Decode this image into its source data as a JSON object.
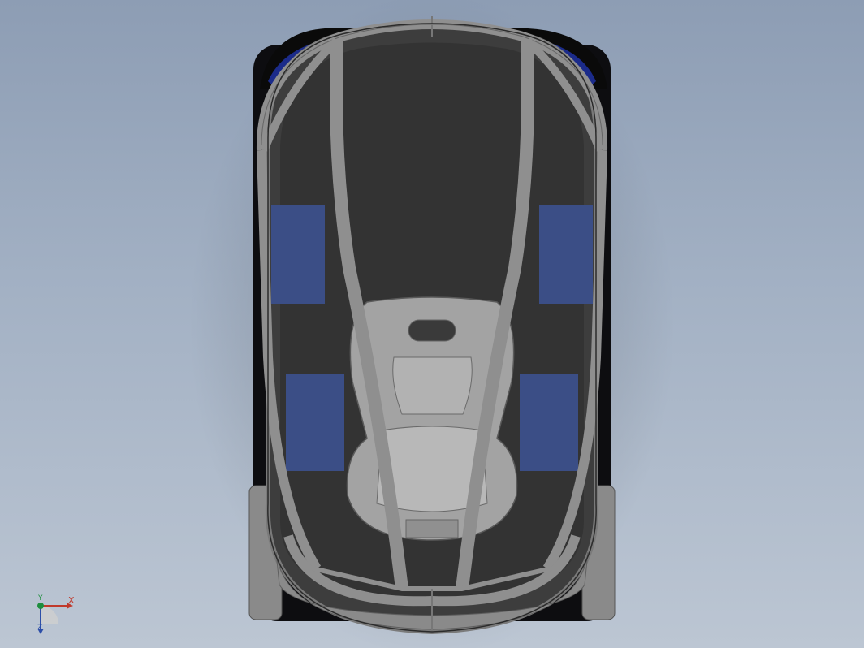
{
  "viewport": {
    "title": "",
    "triad": {
      "x_label": "X",
      "y_label": "Y",
      "z_label": "Z",
      "x_color": "#c0392b",
      "y_color": "#1e8e3e",
      "z_color": "#2c4ea8"
    }
  },
  "model": {
    "body_color": "#3d3d3d",
    "frame_color": "#8f8f8f",
    "panel_color": "#3b4e86",
    "seat_color": "#a3a3a3"
  }
}
